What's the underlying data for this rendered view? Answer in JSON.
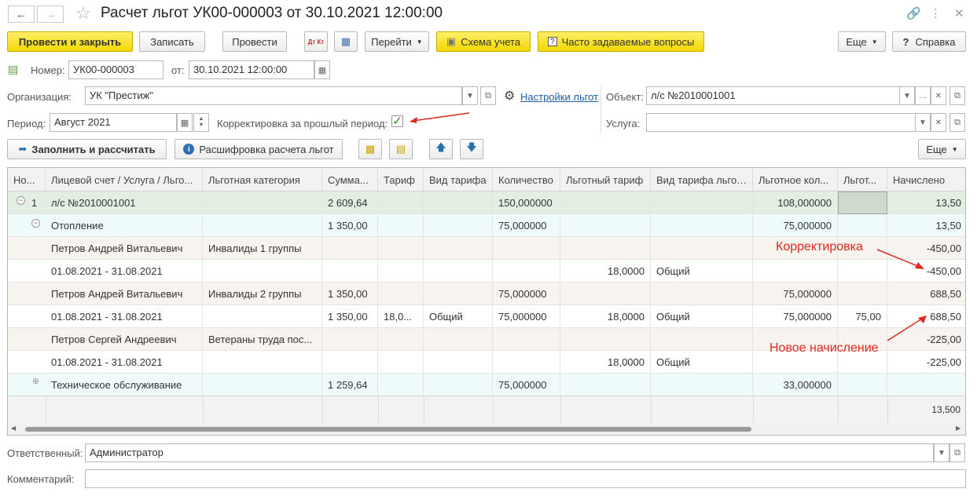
{
  "window": {
    "title": "Расчет льгот УК00-000003 от 30.10.2021 12:00:00"
  },
  "toolbar": {
    "post_close": "Провести и закрыть",
    "write": "Записать",
    "post": "Провести",
    "dt_kt": "Дт Кт",
    "goto": "Перейти",
    "scheme": "Схема учета",
    "faq": "Часто задаваемые вопросы",
    "more": "Еще",
    "help": "Справка"
  },
  "header": {
    "number_label": "Номер:",
    "number_value": "УК00-000003",
    "date_label": "от:",
    "date_value": "30.10.2021 12:00:00",
    "org_label": "Организация:",
    "org_value": "УК \"Престиж\"",
    "settings_link": "Настройки льгот",
    "object_label": "Объект:",
    "object_value": "л/с №2010001001",
    "period_label": "Период:",
    "period_value": "Август 2021",
    "correction_label": "Корректировка за прошлый период:",
    "correction_checked": true,
    "service_label": "Услуга:",
    "service_value": ""
  },
  "table_toolbar": {
    "fill_calc": "Заполнить и рассчитать",
    "decode": "Расшифровка расчета льгот",
    "more": "Еще"
  },
  "table": {
    "columns": [
      "Но...",
      "Лицевой счет / Услуга / Льго...",
      "Льготная категория",
      "Сумма...",
      "Тариф",
      "Вид тарифа",
      "Количество",
      "Льготный тариф",
      "Вид тарифа льготы",
      "Льготное кол...",
      "Льгот...",
      "Начислено"
    ],
    "rows": [
      {
        "num": "1",
        "account": "л/с №2010001001",
        "category": "",
        "sum": "2 609,64",
        "tariff": "",
        "tariff_type": "",
        "qty": "150,000000",
        "priv_tariff": "",
        "priv_tariff_type": "",
        "priv_qty": "108,000000",
        "priv": "",
        "accrued": "13,50"
      },
      {
        "num": "",
        "account": "Отопление",
        "category": "",
        "sum": "1 350,00",
        "tariff": "",
        "tariff_type": "",
        "qty": "75,000000",
        "priv_tariff": "",
        "priv_tariff_type": "",
        "priv_qty": "75,000000",
        "priv": "",
        "accrued": "13,50"
      },
      {
        "num": "",
        "account": "Петров Андрей Витальевич",
        "category": "Инвалиды 1 группы",
        "sum": "",
        "tariff": "",
        "tariff_type": "",
        "qty": "",
        "priv_tariff": "",
        "priv_tariff_type": "",
        "priv_qty": "",
        "priv": "",
        "accrued": "-450,00"
      },
      {
        "num": "",
        "account": "01.08.2021 - 31.08.2021",
        "category": "",
        "sum": "",
        "tariff": "",
        "tariff_type": "",
        "qty": "",
        "priv_tariff": "18,0000",
        "priv_tariff_type": "Общий",
        "priv_qty": "",
        "priv": "",
        "accrued": "-450,00"
      },
      {
        "num": "",
        "account": "Петров Андрей Витальевич",
        "category": "Инвалиды 2 группы",
        "sum": "1 350,00",
        "tariff": "",
        "tariff_type": "",
        "qty": "75,000000",
        "priv_tariff": "",
        "priv_tariff_type": "",
        "priv_qty": "75,000000",
        "priv": "",
        "accrued": "688,50"
      },
      {
        "num": "",
        "account": "01.08.2021 - 31.08.2021",
        "category": "",
        "sum": "1 350,00",
        "tariff": "18,0...",
        "tariff_type": "Общий",
        "qty": "75,000000",
        "priv_tariff": "18,0000",
        "priv_tariff_type": "Общий",
        "priv_qty": "75,000000",
        "priv": "75,00",
        "accrued": "688,50"
      },
      {
        "num": "",
        "account": "Петров Сергей Андреевич",
        "category": "Ветераны труда пос...",
        "sum": "",
        "tariff": "",
        "tariff_type": "",
        "qty": "",
        "priv_tariff": "",
        "priv_tariff_type": "",
        "priv_qty": "",
        "priv": "",
        "accrued": "-225,00"
      },
      {
        "num": "",
        "account": "01.08.2021 - 31.08.2021",
        "category": "",
        "sum": "",
        "tariff": "",
        "tariff_type": "",
        "qty": "",
        "priv_tariff": "18,0000",
        "priv_tariff_type": "Общий",
        "priv_qty": "",
        "priv": "",
        "accrued": "-225,00"
      },
      {
        "num": "",
        "account": "Техническое обслуживание",
        "category": "",
        "sum": "1 259,64",
        "tariff": "",
        "tariff_type": "",
        "qty": "75,000000",
        "priv_tariff": "",
        "priv_tariff_type": "",
        "priv_qty": "33,000000",
        "priv": "",
        "accrued": ""
      }
    ],
    "footer_total": "13,500"
  },
  "annotations": {
    "correction": "Корректировка",
    "new_accrual": "Новое начисление"
  },
  "bottom": {
    "responsible_label": "Ответственный:",
    "responsible_value": "Администратор",
    "comment_label": "Комментарий:",
    "comment_value": ""
  },
  "colors": {
    "accent_yellow": "#f2d700",
    "link_blue": "#1a5ea8",
    "annotation_red": "#e0281e",
    "group_row": "#e2eee2",
    "sub_row": "#effafa",
    "employee_row": "#f7f3ef"
  }
}
